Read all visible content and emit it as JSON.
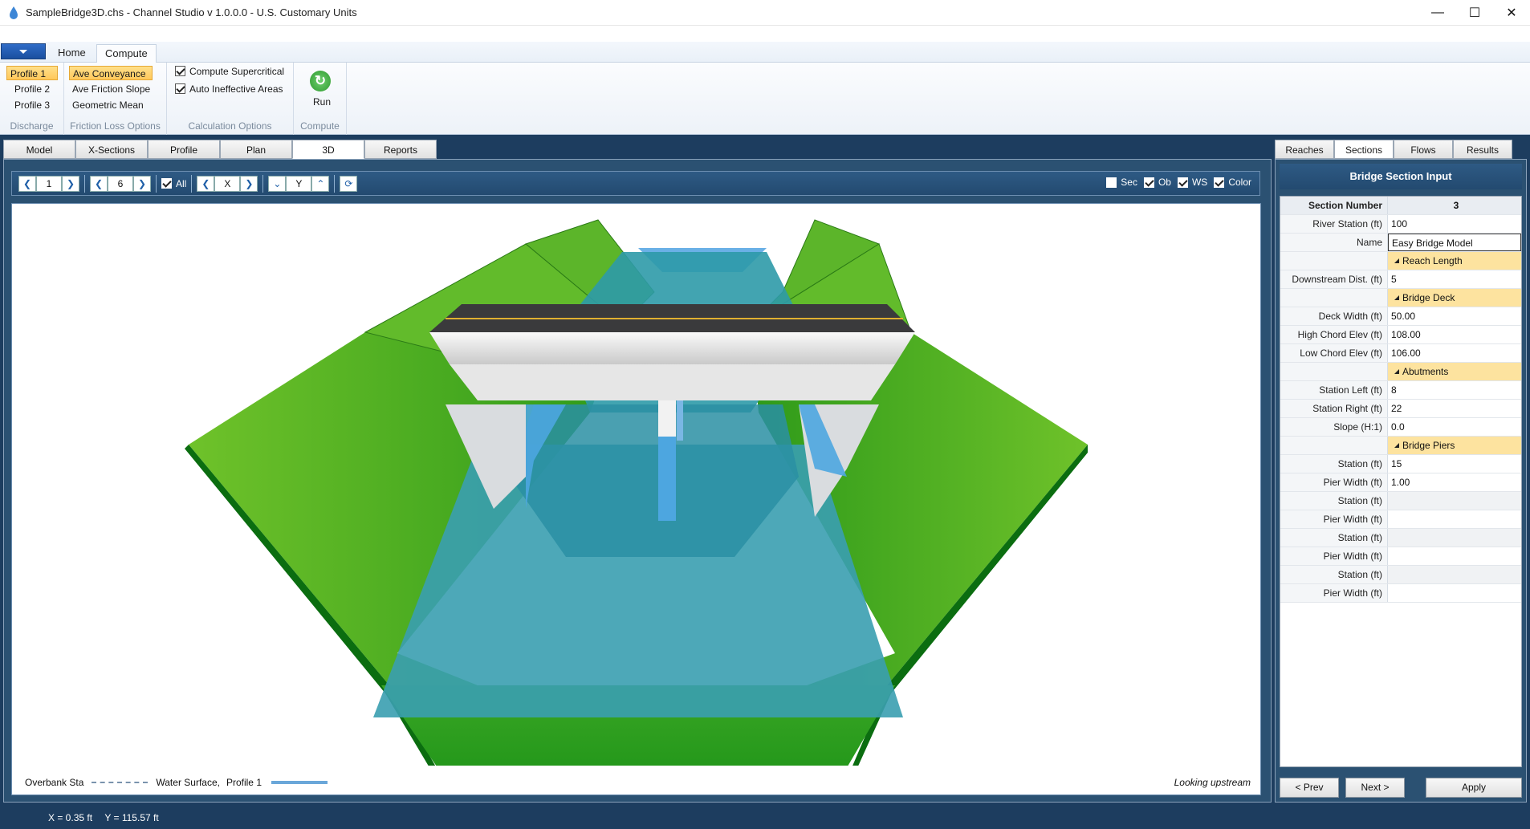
{
  "window": {
    "title": "SampleBridge3D.chs - Channel Studio v 1.0.0.0 - U.S. Customary Units",
    "minimize": "—",
    "maximize": "☐",
    "close": "✕"
  },
  "ribbon": {
    "tabs": [
      {
        "label": "Home"
      },
      {
        "label": "Compute"
      }
    ],
    "discharge": {
      "items": [
        "Profile 1",
        "Profile 2",
        "Profile 3"
      ],
      "label": "Discharge"
    },
    "friction": {
      "items": [
        "Ave Conveyance",
        "Ave Friction Slope",
        "Geometric Mean"
      ],
      "label": "Friction Loss Options"
    },
    "calc": {
      "items": [
        "Compute Supercritical",
        "Auto Ineffective Areas"
      ],
      "label": "Calculation Options"
    },
    "compute": {
      "run": "Run",
      "label": "Compute"
    }
  },
  "view_tabs": [
    "Model",
    "X-Sections",
    "Profile",
    "Plan",
    "3D",
    "Reports"
  ],
  "toolbar": {
    "section_value": "1",
    "count_value": "6",
    "all_label": "All",
    "x_label": "X",
    "y_label": "Y",
    "sec_label": "Sec",
    "ob_label": "Ob",
    "ws_label": "WS",
    "color_label": "Color"
  },
  "legend": {
    "overbank": "Overbank Sta",
    "water_surface": "Water Surface,",
    "profile": "Profile 1",
    "looking": "Looking upstream"
  },
  "right_tabs": [
    "Reaches",
    "Sections",
    "Flows",
    "Results"
  ],
  "panel": {
    "title": "Bridge Section Input",
    "rows": [
      {
        "label": "Section Number",
        "value": "3"
      },
      {
        "label": "River Station (ft)",
        "value": "100"
      },
      {
        "label": "Name",
        "value": "Easy Bridge Model"
      },
      {
        "label": "",
        "value": "Reach Length"
      },
      {
        "label": "Downstream Dist. (ft)",
        "value": "5"
      },
      {
        "label": "",
        "value": "Bridge Deck"
      },
      {
        "label": "Deck Width (ft)",
        "value": "50.00"
      },
      {
        "label": "High Chord Elev (ft)",
        "value": "108.00"
      },
      {
        "label": "Low Chord Elev (ft)",
        "value": "106.00"
      },
      {
        "label": "",
        "value": "Abutments"
      },
      {
        "label": "Station Left (ft)",
        "value": "8"
      },
      {
        "label": "Station Right (ft)",
        "value": "22"
      },
      {
        "label": "Slope (H:1)",
        "value": "0.0"
      },
      {
        "label": "",
        "value": "Bridge Piers"
      },
      {
        "label": "Station (ft)",
        "value": "15"
      },
      {
        "label": "Pier Width (ft)",
        "value": "1.00"
      },
      {
        "label": "Station (ft)",
        "value": ""
      },
      {
        "label": "Pier Width (ft)",
        "value": ""
      },
      {
        "label": "Station (ft)",
        "value": ""
      },
      {
        "label": "Pier Width (ft)",
        "value": ""
      },
      {
        "label": "Station (ft)",
        "value": ""
      },
      {
        "label": "Pier Width (ft)",
        "value": ""
      }
    ],
    "prev": "< Prev",
    "next": "Next >",
    "apply": "Apply"
  },
  "status": {
    "x": "X = 0.35 ft",
    "y": "Y = 115.57 ft"
  }
}
